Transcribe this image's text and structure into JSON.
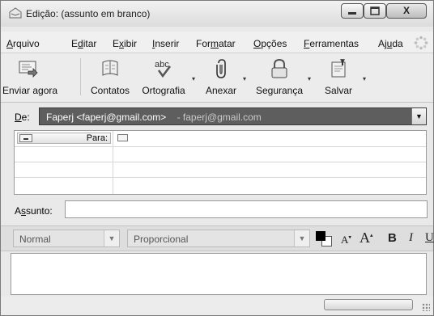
{
  "window": {
    "title": "Edição: (assunto em branco)",
    "buttons": {
      "minimize": "–",
      "maximize": "▫",
      "close": "X"
    }
  },
  "menu": [
    {
      "pre": "",
      "key": "A",
      "post": "rquivo"
    },
    {
      "pre": "E",
      "key": "d",
      "post": "itar"
    },
    {
      "pre": "E",
      "key": "x",
      "post": "ibir"
    },
    {
      "pre": "",
      "key": "I",
      "post": "nserir"
    },
    {
      "pre": "For",
      "key": "m",
      "post": "atar"
    },
    {
      "pre": "",
      "key": "O",
      "post": "pções"
    },
    {
      "pre": "",
      "key": "F",
      "post": "erramentas"
    },
    {
      "pre": "Aj",
      "key": "u",
      "post": "da"
    }
  ],
  "toolbar": {
    "send": "Enviar agora",
    "contacts": "Contatos",
    "spelling": "Ortografia",
    "attach": "Anexar",
    "security": "Segurança",
    "save": "Salvar",
    "spelling_icon_text": "abc"
  },
  "from": {
    "label_key": "D",
    "label_rest": "e:",
    "identity": "Faperj <faperj@gmail.com>",
    "account": "- faperj@gmail.com"
  },
  "recipients": {
    "type_label": "Para:",
    "rows": 4
  },
  "subject": {
    "label_pre": "A",
    "label_key": "s",
    "label_post": "sunto:",
    "value": ""
  },
  "format": {
    "paragraph": "Normal",
    "font": "Proporcional",
    "smaller": "A",
    "larger": "A",
    "bold": "B",
    "italic": "I",
    "underline": "U"
  },
  "colors": {
    "from_select_bg": "#5e5e5e",
    "text_color_swatch": "#000000"
  },
  "icons": {
    "send": "send-icon",
    "contacts": "address-book-icon",
    "spelling": "spellcheck-icon",
    "attach": "paperclip-icon",
    "security": "padlock-icon",
    "save": "save-icon"
  }
}
